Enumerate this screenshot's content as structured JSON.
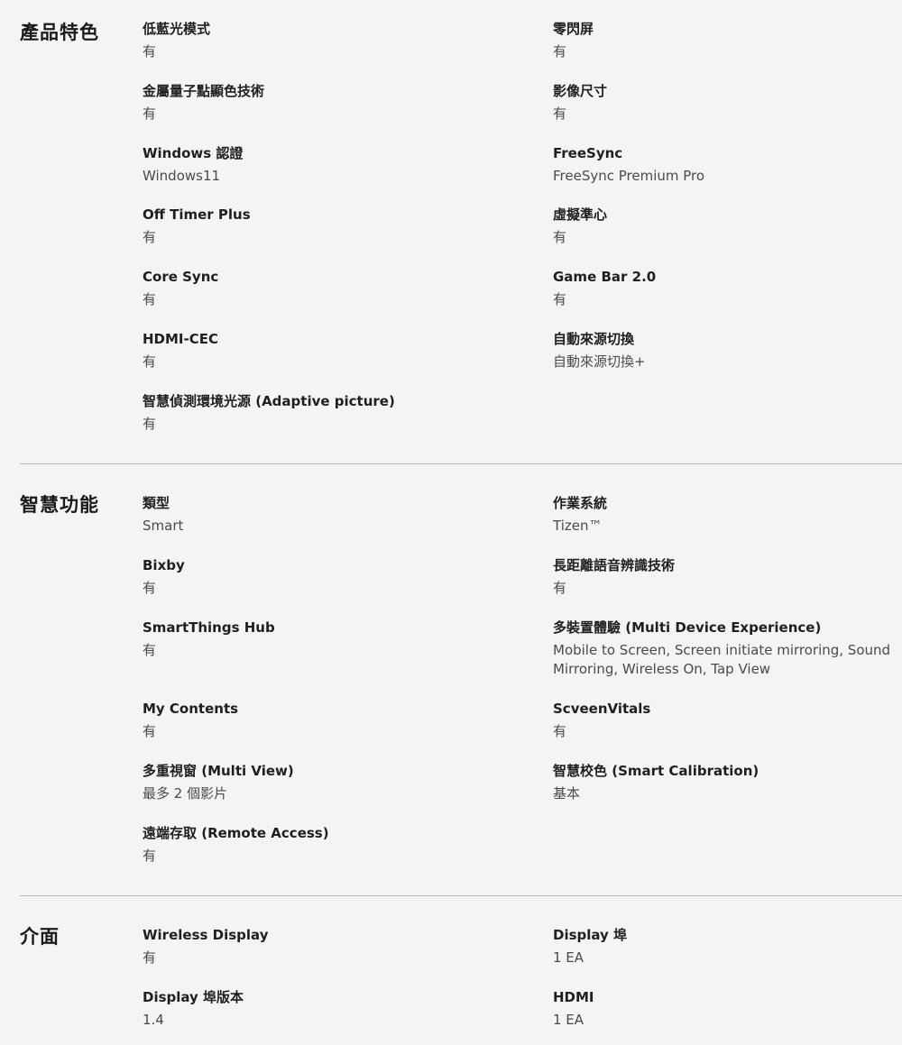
{
  "sections": [
    {
      "title": "產品特色",
      "items": [
        {
          "label": "低藍光模式",
          "value": "有"
        },
        {
          "label": "零閃屏",
          "value": "有"
        },
        {
          "label": "金屬量子點顯色技術",
          "value": "有"
        },
        {
          "label": "影像尺寸",
          "value": "有"
        },
        {
          "label": "Windows 認證",
          "value": "Windows11"
        },
        {
          "label": "FreeSync",
          "value": "FreeSync Premium Pro"
        },
        {
          "label": "Off Timer Plus",
          "value": "有"
        },
        {
          "label": "虛擬準心",
          "value": "有"
        },
        {
          "label": "Core Sync",
          "value": "有"
        },
        {
          "label": "Game Bar 2.0",
          "value": "有"
        },
        {
          "label": "HDMI-CEC",
          "value": "有"
        },
        {
          "label": "自動來源切換",
          "value": "自動來源切換+"
        },
        {
          "label": "智慧偵測環境光源 (Adaptive picture)",
          "value": "有"
        }
      ]
    },
    {
      "title": "智慧功能",
      "items": [
        {
          "label": "類型",
          "value": "Smart"
        },
        {
          "label": "作業系統",
          "value": "Tizen™"
        },
        {
          "label": "Bixby",
          "value": "有"
        },
        {
          "label": "長距離語音辨識技術",
          "value": "有"
        },
        {
          "label": "SmartThings Hub",
          "value": "有"
        },
        {
          "label": "多裝置體驗 (Multi Device Experience)",
          "value": "Mobile to Screen, Screen initiate mirroring, Sound Mirroring, Wireless On, Tap View"
        },
        {
          "label": "My Contents",
          "value": "有"
        },
        {
          "label": "ScveenVitals",
          "value": "有"
        },
        {
          "label": "多重視窗 (Multi View)",
          "value": "最多 2 個影片"
        },
        {
          "label": "智慧校色 (Smart Calibration)",
          "value": "基本"
        },
        {
          "label": "遠端存取 (Remote Access)",
          "value": "有"
        }
      ]
    },
    {
      "title": "介面",
      "items": [
        {
          "label": "Wireless Display",
          "value": "有"
        },
        {
          "label": "Display 埠",
          "value": "1 EA"
        },
        {
          "label": "Display 埠版本",
          "value": "1.4"
        },
        {
          "label": "HDMI",
          "value": "1 EA"
        }
      ]
    }
  ]
}
